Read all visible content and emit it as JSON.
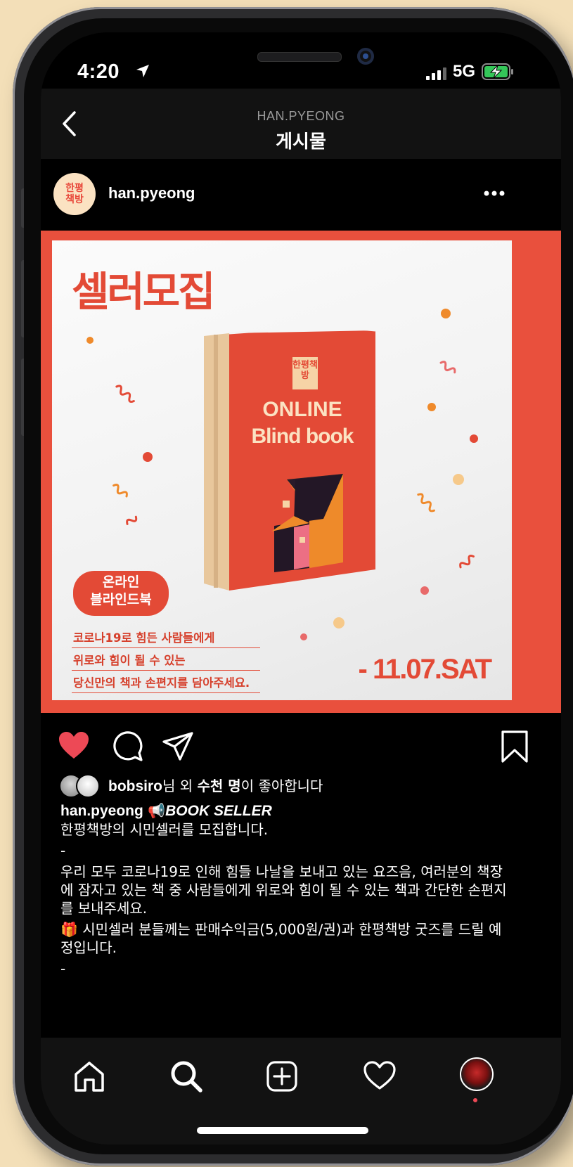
{
  "status_bar": {
    "time": "4:20",
    "network": "5G"
  },
  "header": {
    "subtitle": "HAN.PYEONG",
    "title": "게시물"
  },
  "post": {
    "username": "han.pyeong",
    "avatar_text": "한평책방",
    "image": {
      "headline": "셀러모집",
      "book_logo": "한평책방",
      "book_title_line1": "ONLINE",
      "book_title_line2": "Blind book",
      "bubble_line1": "온라인",
      "bubble_line2": "블라인드북",
      "lines": [
        "코로나19로 힘든 사람들에게",
        "위로와 힘이 될 수 있는",
        "당신만의 책과 손편지를 담아주세요."
      ],
      "date": "- 11.07.SAT"
    },
    "likes": {
      "user": "bobsiro",
      "text_mid": "님 외 ",
      "count": "수천 명",
      "text_end": "이 좋아합니다"
    },
    "caption": {
      "user": "han.pyeong",
      "tag_emoji": "📢",
      "tag": "BOOK SELLER",
      "line1": "한평책방의 시민셀러를 모집합니다.",
      "dash1": "-",
      "line2": "우리 모두 코로나19로 인해 힘들 나날을 보내고 있는 요즈음, 여러분의 책장에 잠자고 있는 책 중 사람들에게 위로와 힘이 될 수 있는 책과 간단한 손편지를 보내주세요.",
      "line3": "🎁 시민셀러 분들께는 판매수익금(5,000원/권)과 한평책방 굿즈를 드릴 예정입니다.",
      "dash2": "-"
    }
  },
  "colors": {
    "accent": "#e9503d",
    "like": "#ed4956",
    "background": "#000000"
  },
  "icons": [
    "back-chevron-icon",
    "more-dots-icon",
    "heart-filled-icon",
    "comment-icon",
    "share-icon",
    "bookmark-icon",
    "home-icon",
    "search-icon",
    "add-post-icon",
    "activity-heart-icon",
    "profile-avatar-icon"
  ]
}
